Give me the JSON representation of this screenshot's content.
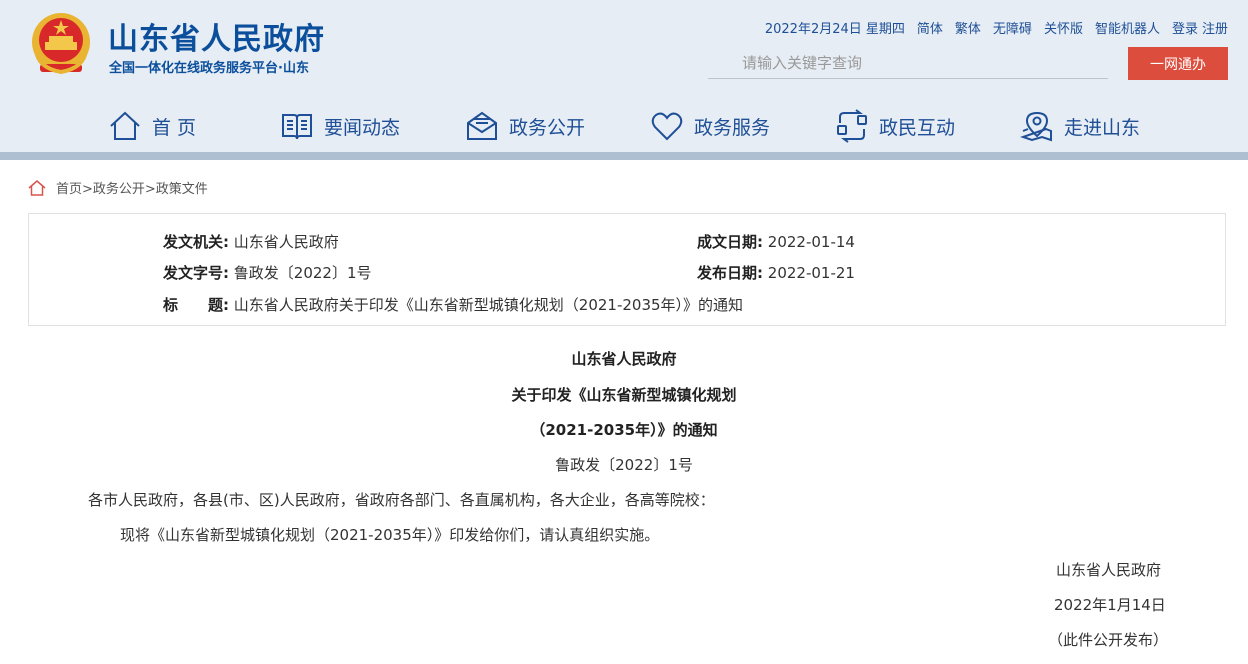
{
  "header": {
    "site_title": "山东省人民政府",
    "site_subtitle": "全国一体化在线政务服务平台·山东",
    "date": "2022年2月24日 星期四",
    "links": [
      "简体",
      "繁体",
      "无障碍",
      "关怀版",
      "智能机器人"
    ],
    "login": "登录",
    "register": "注册",
    "search_placeholder": "请输入关键字查询",
    "portal_button": "一网通办"
  },
  "nav": {
    "items": [
      {
        "label": "首 页",
        "icon": "home-icon"
      },
      {
        "label": "要闻动态",
        "icon": "book-icon"
      },
      {
        "label": "政务公开",
        "icon": "envelope-icon"
      },
      {
        "label": "政务服务",
        "icon": "heart-icon"
      },
      {
        "label": "政民互动",
        "icon": "interaction-icon"
      },
      {
        "label": "走进山东",
        "icon": "location-icon"
      }
    ]
  },
  "breadcrumb": "首页>政务公开>政策文件",
  "info": {
    "issuer_label": "发文机关:",
    "issuer": "山东省人民政府",
    "date_label": "成文日期:",
    "date": "2022-01-14",
    "number_label": "发文字号:",
    "number": "鲁政发〔2022〕1号",
    "pub_label": "发布日期:",
    "pub_date": "2022-01-21",
    "title_label": "标　　题:",
    "title": "山东省人民政府关于印发《山东省新型城镇化规划（2021-2035年）》的通知"
  },
  "document": {
    "heading1": "山东省人民政府",
    "heading2": "关于印发《山东省新型城镇化规划",
    "heading3": "（2021-2035年）》的通知",
    "doc_no": "鲁政发〔2022〕1号",
    "recipients": "各市人民政府，各县(市、区)人民政府，省政府各部门、各直属机构，各大企业，各高等院校：",
    "body": "现将《山东省新型城镇化规划（2021-2035年）》印发给你们，请认真组织实施。",
    "signature": "山东省人民政府",
    "sign_date": "2022年1月14日",
    "note": "（此件公开发布）"
  },
  "colors": {
    "brand_blue": "#0b4f9c",
    "header_bg": "#e6edf4",
    "portal_red": "#dc4d3d"
  }
}
